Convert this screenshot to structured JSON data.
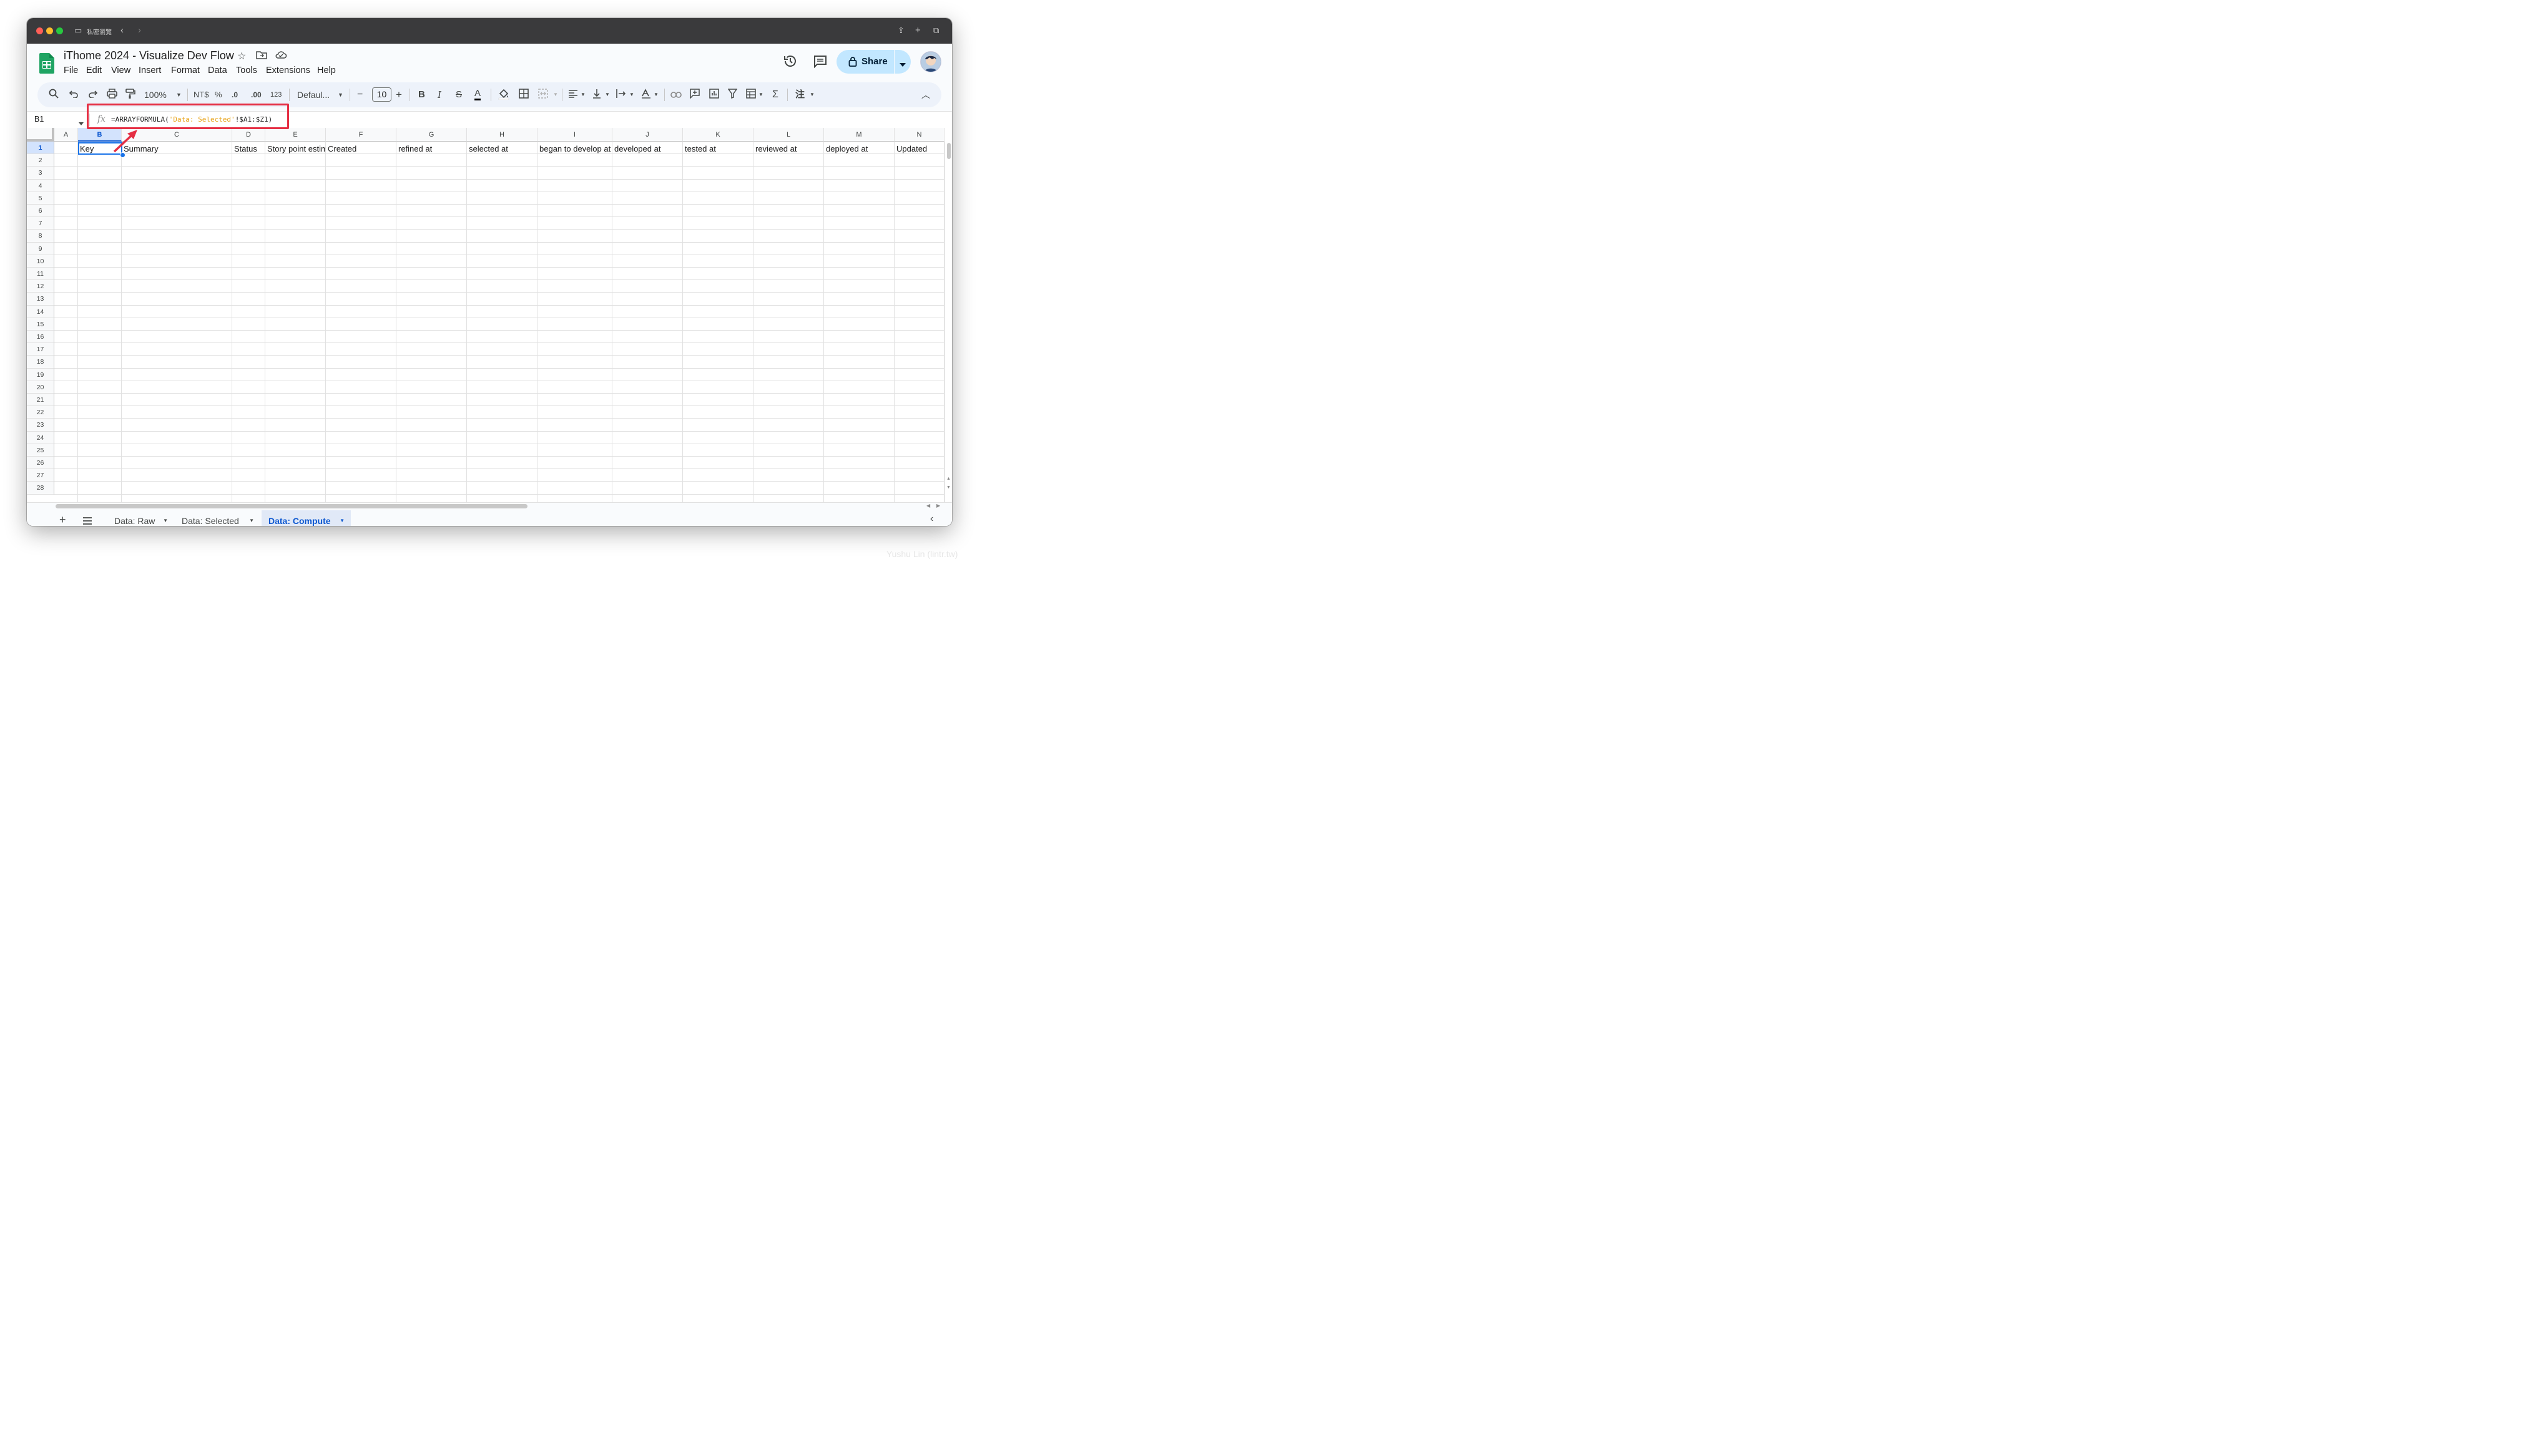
{
  "browser": {
    "private_label": "私密瀏覽"
  },
  "document": {
    "title": "iThome 2024 - Visualize Dev Flow"
  },
  "menu": [
    "File",
    "Edit",
    "View",
    "Insert",
    "Format",
    "Data",
    "Tools",
    "Extensions",
    "Help"
  ],
  "header": {
    "share_label": "Share"
  },
  "toolbar": {
    "zoom": "100%",
    "currency": "NT$",
    "percent": "%",
    "decrease_decimal": ".0",
    "increase_decimal": ".00",
    "number_format": "123",
    "font": "Defaul...",
    "font_size": "10",
    "minus": "−",
    "plus": "+"
  },
  "formula_bar": {
    "cell_ref": "B1",
    "fx": "fx",
    "formula_prefix": "=ARRAYFORMULA(",
    "formula_string": "'Data: Selected'",
    "formula_suffix": "!$A1:$Z1)"
  },
  "grid": {
    "columns": [
      "A",
      "B",
      "C",
      "D",
      "E",
      "F",
      "G",
      "H",
      "I",
      "J",
      "K",
      "L",
      "M",
      "N"
    ],
    "selected_column": "B",
    "selected_row": 1,
    "rows": [
      "1",
      "2",
      "3",
      "4",
      "5",
      "6",
      "7",
      "8",
      "9",
      "10",
      "11",
      "12",
      "13",
      "14",
      "15",
      "16",
      "17",
      "18",
      "19",
      "20",
      "21",
      "22",
      "23",
      "24",
      "25",
      "26",
      "27",
      "28"
    ],
    "row1": [
      "",
      "Key",
      "Summary",
      "Status",
      "Story point estim",
      "Created",
      "refined at",
      "selected at",
      "began to develop at",
      "developed at",
      "tested at",
      "reviewed at",
      "deployed at",
      "Updated"
    ]
  },
  "sheets": [
    {
      "name": "Data: Raw",
      "active": false
    },
    {
      "name": "Data: Selected",
      "active": false
    },
    {
      "name": "Data: Compute",
      "active": true
    }
  ],
  "watermark": "Yushu Lin (lintr.tw)",
  "colors": {
    "highlight": "#e52e43",
    "selection": "#1a73e8",
    "sheets_green": "#1fa463",
    "share_bg": "#c2e7ff"
  }
}
